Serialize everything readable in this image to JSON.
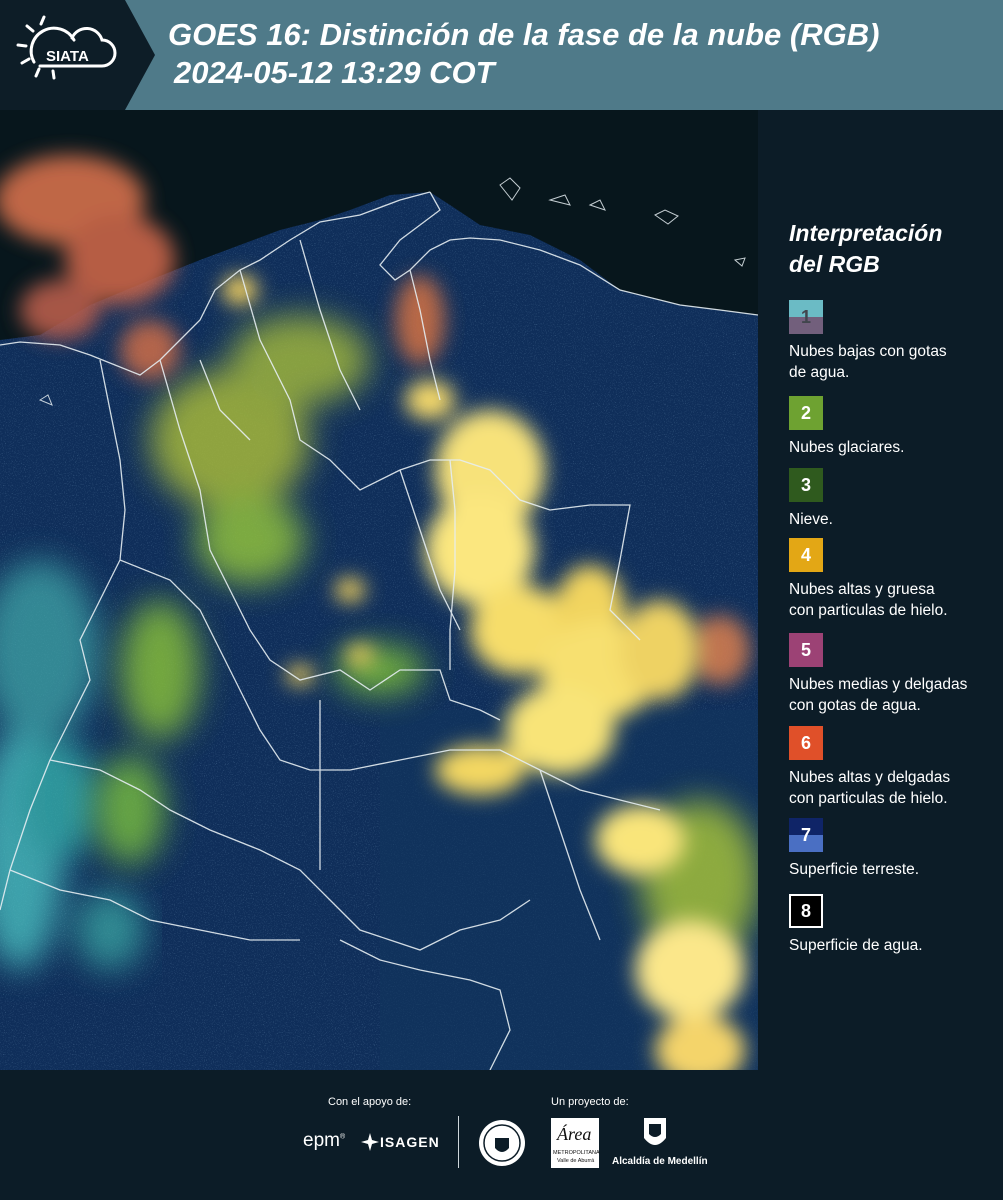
{
  "header": {
    "logo_text": "SIATA",
    "title_line1": "GOES 16: Distinción de la fase de la nube (RGB)",
    "title_line2": "2024-05-12 13:29 COT",
    "background_color": "#4f7a89"
  },
  "map": {
    "description_icon": "satellite-rgb-image",
    "palette": {
      "water": "#07161c",
      "land": "#0f2e5a",
      "ice_cloud": "#f2dc55",
      "glaciated_cloud": "#a9c13a",
      "thin_ice_cloud": "#e2704a",
      "low_cloud": "#58c7c4"
    }
  },
  "legend": {
    "title_line1": "Interpretación",
    "title_line2": "del RGB",
    "items": [
      {
        "number": "1",
        "label_line1": "Nubes bajas con gotas",
        "label_line2": "de agua.",
        "color_top": "#6bbbc5",
        "color_bottom": "#725f7c"
      },
      {
        "number": "2",
        "label_line1": "Nubes glaciares.",
        "label_line2": "",
        "color": "#6ea231"
      },
      {
        "number": "3",
        "label_line1": "Nieve.",
        "label_line2": "",
        "color": "#2f5a1e"
      },
      {
        "number": "4",
        "label_line1": "Nubes altas y gruesa",
        "label_line2": "con particulas de hielo.",
        "color": "#e3a715"
      },
      {
        "number": "5",
        "label_line1": "Nubes medias y delgadas",
        "label_line2": "con gotas de agua.",
        "color": "#9c4275"
      },
      {
        "number": "6",
        "label_line1": "Nubes altas y delgadas",
        "label_line2": "con particulas de hielo.",
        "color": "#e05029"
      },
      {
        "number": "7",
        "label_line1": "Superficie terreste.",
        "label_line2": "",
        "color_top": "#0f2467",
        "color_bottom": "#4a6fc3"
      },
      {
        "number": "8",
        "label_line1": "Superficie de agua.",
        "label_line2": "",
        "color": "#000000"
      }
    ]
  },
  "footer": {
    "support_label": "Con el apoyo de:",
    "project_label": "Un proyecto de:",
    "sponsor1": "epm",
    "sponsor2": "ISAGEN",
    "partner_area_script": "Área",
    "partner_area_line1": "METROPOLITANA",
    "partner_area_line2": "Valle de Aburrá",
    "partner_alcaldia": "Alcaldía de Medellín"
  }
}
